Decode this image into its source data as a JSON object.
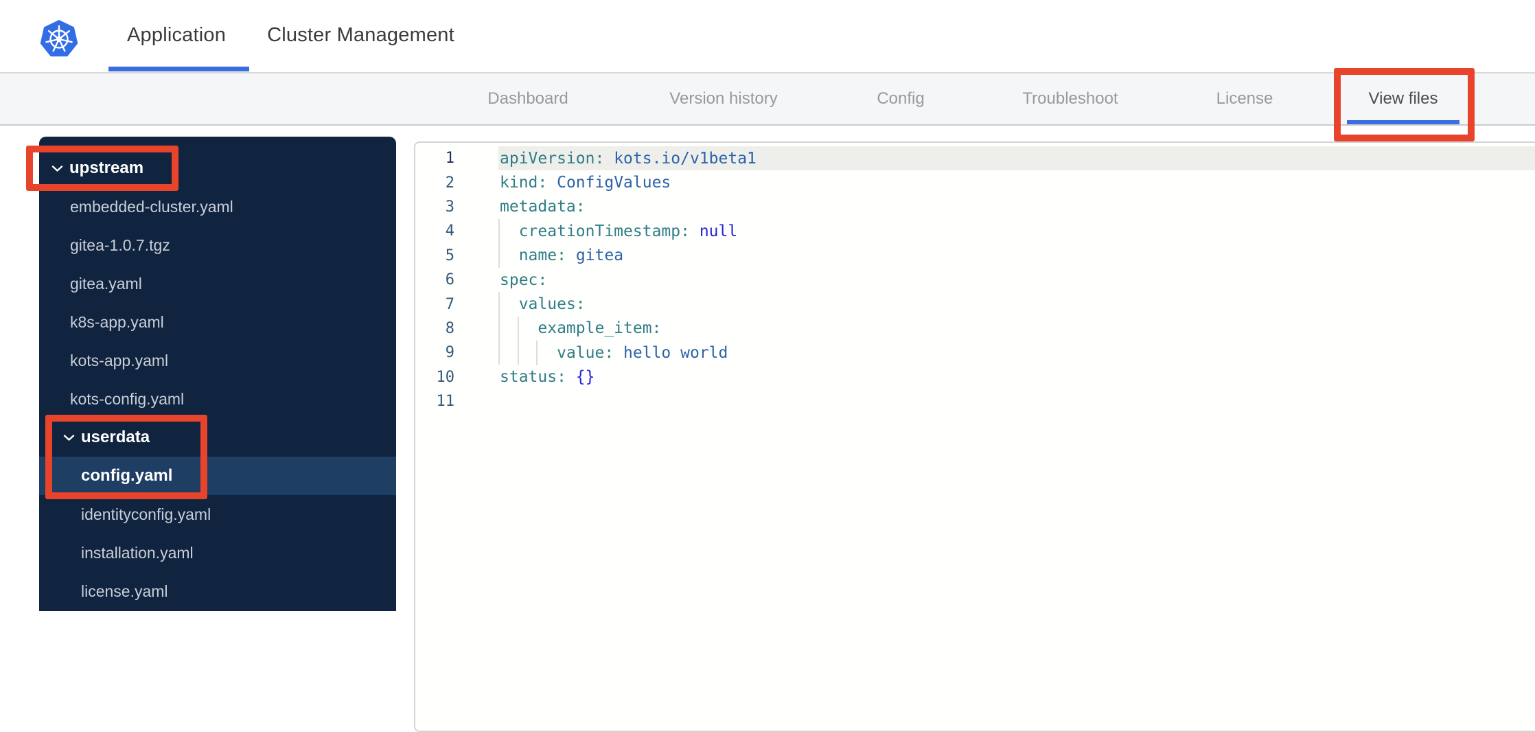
{
  "header": {
    "tabs": [
      {
        "label": "Application",
        "active": true
      },
      {
        "label": "Cluster Management",
        "active": false
      }
    ]
  },
  "nav": {
    "tabs": [
      {
        "label": "Dashboard",
        "active": false
      },
      {
        "label": "Version history",
        "active": false
      },
      {
        "label": "Config",
        "active": false
      },
      {
        "label": "Troubleshoot",
        "active": false
      },
      {
        "label": "License",
        "active": false
      },
      {
        "label": "View files",
        "active": true
      }
    ]
  },
  "sidebar": {
    "tree": [
      {
        "type": "folder",
        "label": "upstream",
        "level": 0,
        "expanded": true
      },
      {
        "type": "file",
        "label": "embedded-cluster.yaml",
        "level": 1
      },
      {
        "type": "file",
        "label": "gitea-1.0.7.tgz",
        "level": 1
      },
      {
        "type": "file",
        "label": "gitea.yaml",
        "level": 1
      },
      {
        "type": "file",
        "label": "k8s-app.yaml",
        "level": 1
      },
      {
        "type": "file",
        "label": "kots-app.yaml",
        "level": 1
      },
      {
        "type": "file",
        "label": "kots-config.yaml",
        "level": 1
      },
      {
        "type": "folder",
        "label": "userdata",
        "level": 1,
        "expanded": true
      },
      {
        "type": "file",
        "label": "config.yaml",
        "level": 2,
        "selected": true
      },
      {
        "type": "file",
        "label": "identityconfig.yaml",
        "level": 2
      },
      {
        "type": "file",
        "label": "installation.yaml",
        "level": 2
      },
      {
        "type": "file",
        "label": "license.yaml",
        "level": 2
      }
    ]
  },
  "editor": {
    "language": "yaml",
    "lines": [
      {
        "number": 1,
        "active": true,
        "tokens": [
          [
            "key",
            "apiVersion:"
          ],
          [
            "plain",
            " "
          ],
          [
            "value",
            "kots.io/v1beta1"
          ]
        ]
      },
      {
        "number": 2,
        "tokens": [
          [
            "key",
            "kind:"
          ],
          [
            "plain",
            " "
          ],
          [
            "value",
            "ConfigValues"
          ]
        ]
      },
      {
        "number": 3,
        "tokens": [
          [
            "key",
            "metadata:"
          ]
        ]
      },
      {
        "number": 4,
        "tokens": [
          [
            "plain",
            "  "
          ],
          [
            "key",
            "creationTimestamp:"
          ],
          [
            "plain",
            " "
          ],
          [
            "bright",
            "null"
          ]
        ]
      },
      {
        "number": 5,
        "tokens": [
          [
            "plain",
            "  "
          ],
          [
            "key",
            "name:"
          ],
          [
            "plain",
            " "
          ],
          [
            "value",
            "gitea"
          ]
        ]
      },
      {
        "number": 6,
        "tokens": [
          [
            "key",
            "spec:"
          ]
        ]
      },
      {
        "number": 7,
        "tokens": [
          [
            "plain",
            "  "
          ],
          [
            "key",
            "values:"
          ]
        ]
      },
      {
        "number": 8,
        "tokens": [
          [
            "plain",
            "    "
          ],
          [
            "key",
            "example_item:"
          ]
        ]
      },
      {
        "number": 9,
        "tokens": [
          [
            "plain",
            "      "
          ],
          [
            "key",
            "value:"
          ],
          [
            "plain",
            " "
          ],
          [
            "value",
            "hello world"
          ]
        ]
      },
      {
        "number": 10,
        "tokens": [
          [
            "key",
            "status:"
          ],
          [
            "plain",
            " "
          ],
          [
            "bright",
            "{}"
          ]
        ]
      },
      {
        "number": 11,
        "tokens": []
      }
    ]
  },
  "annotations": [
    {
      "target": "view-files-tab"
    },
    {
      "target": "upstream-folder"
    },
    {
      "target": "userdata-config-yaml"
    }
  ],
  "colors": {
    "accent_blue": "#3b6ce0",
    "annotation_red": "#e8432b",
    "kubernetes_blue": "#326de6",
    "sidebar_bg": "#10233f",
    "sidebar_selected_bg": "#1f3e64",
    "code_key": "#2f7e86",
    "code_value": "#2d63a8",
    "code_bright": "#2424d8"
  }
}
